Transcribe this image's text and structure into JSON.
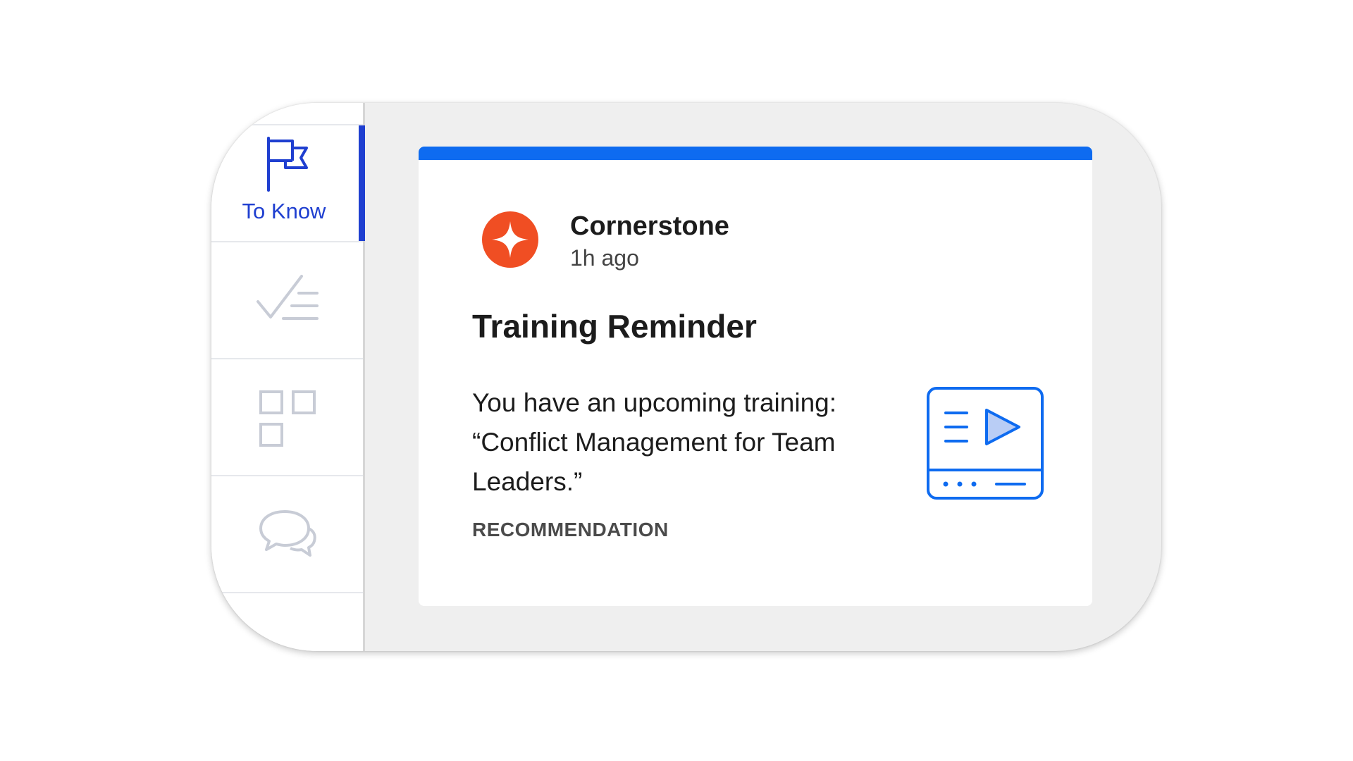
{
  "sidebar": {
    "items": [
      {
        "label": "To Know",
        "icon": "flag-icon",
        "active": true
      },
      {
        "label": "",
        "icon": "checklist-icon",
        "active": false
      },
      {
        "label": "",
        "icon": "apps-grid-icon",
        "active": false
      },
      {
        "label": "",
        "icon": "chat-bubbles-icon",
        "active": false
      }
    ]
  },
  "card": {
    "sender": "Cornerstone",
    "time": "1h ago",
    "title": "Training Reminder",
    "body_line1": "You have an upcoming training:",
    "body_line2": "“Conflict Management for Team Leaders.”",
    "category": "RECOMMENDATION",
    "logo_icon": "cornerstone-logo",
    "media_icon": "video-lesson-icon"
  },
  "colors": {
    "accent": "#0e6bf0",
    "active_nav": "#1f3fd0",
    "inactive_icon": "#c8ccd6",
    "logo": "#f04e23"
  }
}
